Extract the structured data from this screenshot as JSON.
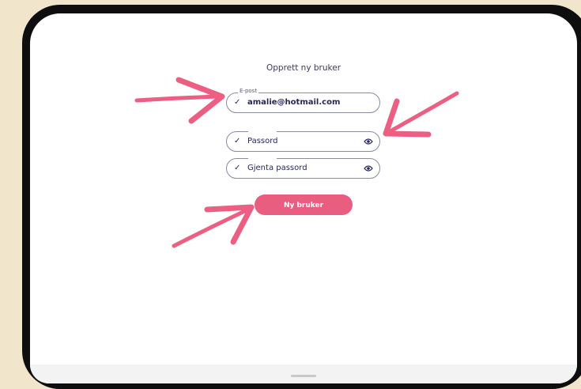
{
  "form": {
    "title": "Opprett ny bruker",
    "email": {
      "legend": "E-post",
      "value": "amalie@hotmail.com",
      "valid": true
    },
    "password": {
      "placeholder": "Passord",
      "valid": true,
      "icon": "eye-icon"
    },
    "repeat_password": {
      "placeholder": "Gjenta passord",
      "valid": true,
      "icon": "eye-icon"
    },
    "submit_label": "Ny bruker",
    "check_glyph": "✓"
  },
  "colors": {
    "accent": "#e85d80",
    "text_dark": "#26265a",
    "background": "#f1e6cc",
    "device_frame": "#0e0e0e"
  }
}
